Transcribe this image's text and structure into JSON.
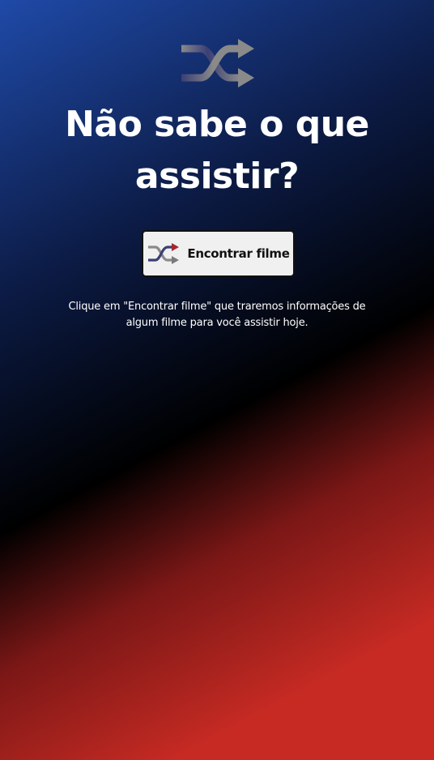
{
  "hero": {
    "logo_icon": "shuffle-icon",
    "title": "Não sabe o que assistir?",
    "description": "Clique em \"Encontrar filme\" que traremos informações de algum filme para você assistir hoje."
  },
  "find_button": {
    "icon": "shuffle-icon",
    "label": "Encontrar filme"
  },
  "colors": {
    "red": "#c62a23",
    "black": "#000000",
    "blue": "#1f4aa8",
    "button_bg": "#f0f0f0",
    "icon_grey": "#808080",
    "icon_navy": "#3b3f74",
    "icon_red": "#a6262b"
  }
}
